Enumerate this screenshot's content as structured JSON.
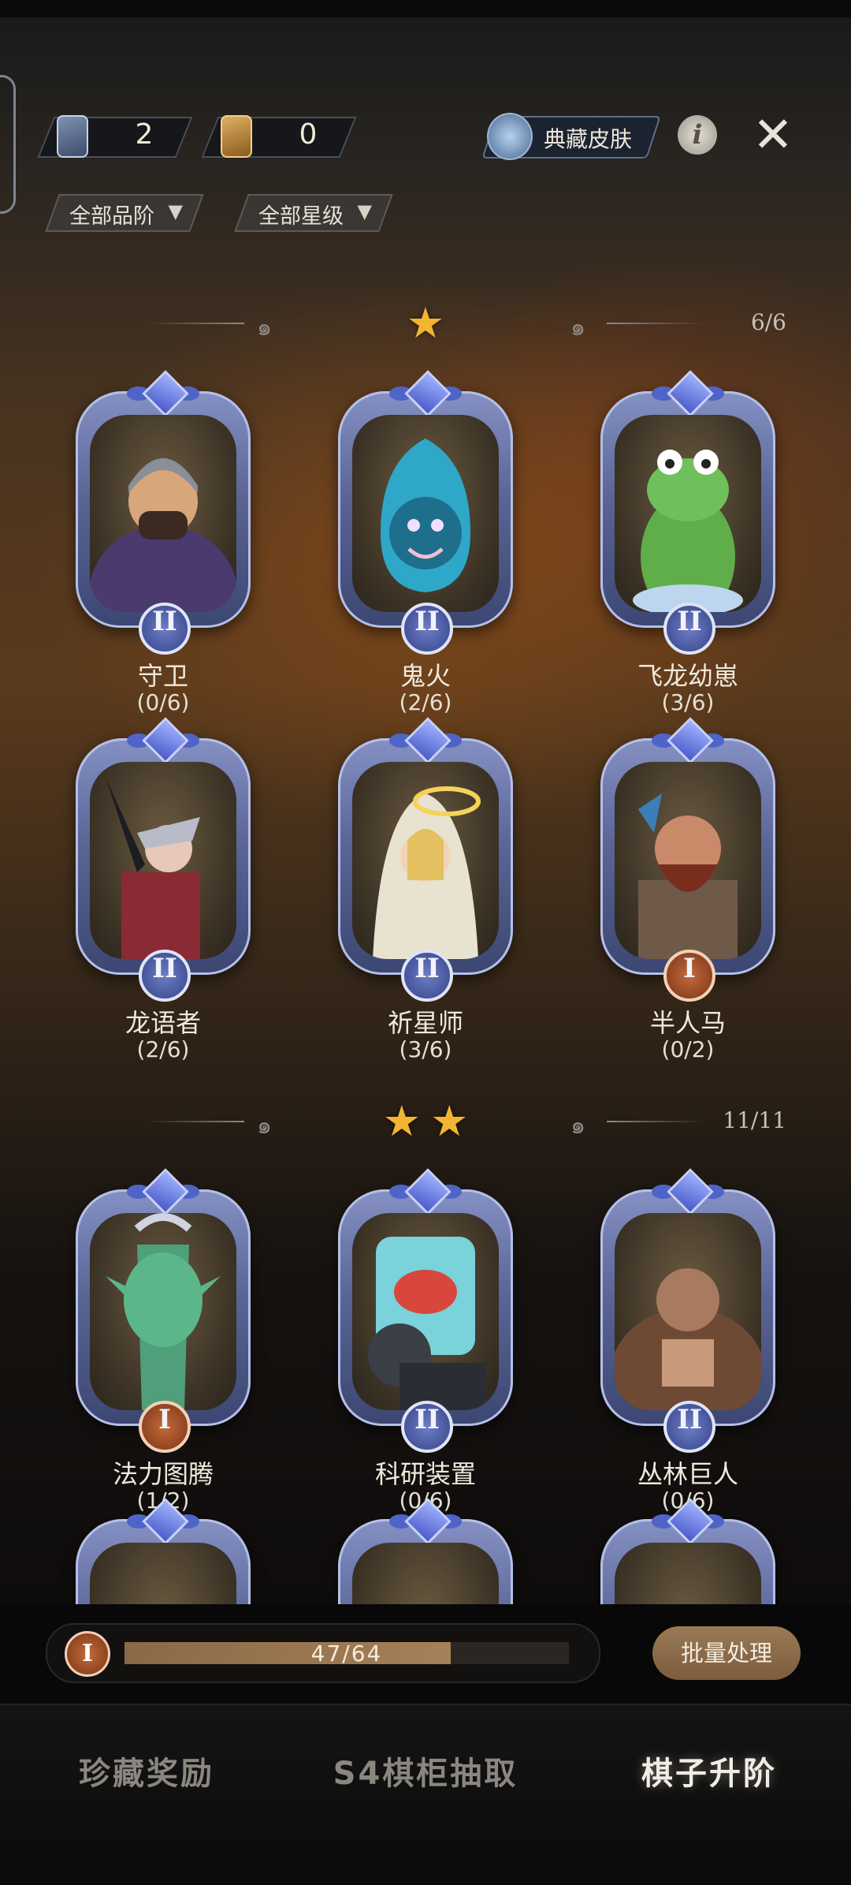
{
  "resources": [
    {
      "icon": "blue-card-icon",
      "value": "2"
    },
    {
      "icon": "gold-card-icon",
      "value": "0"
    }
  ],
  "skin_button": {
    "icon": "shirt-icon",
    "label": "典藏皮肤"
  },
  "filters": [
    {
      "label": "全部品阶"
    },
    {
      "label": "全部星级"
    }
  ],
  "sections": [
    {
      "stars": 1,
      "count": "6/6",
      "cards": [
        {
          "name": "守卫",
          "progress": "(0/6)",
          "rank": "II",
          "rank_color": "#4a5ab0"
        },
        {
          "name": "鬼火",
          "progress": "(2/6)",
          "rank": "II",
          "rank_color": "#4a5ab0"
        },
        {
          "name": "飞龙幼崽",
          "progress": "(3/6)",
          "rank": "II",
          "rank_color": "#4a5ab0"
        },
        {
          "name": "龙语者",
          "progress": "(2/6)",
          "rank": "II",
          "rank_color": "#4a5ab0"
        },
        {
          "name": "祈星师",
          "progress": "(3/6)",
          "rank": "II",
          "rank_color": "#4a5ab0"
        },
        {
          "name": "半人马",
          "progress": "(0/2)",
          "rank": "I",
          "rank_color": "#a4532c"
        }
      ]
    },
    {
      "stars": 2,
      "count": "11/11",
      "cards": [
        {
          "name": "法力图腾",
          "progress": "(1/2)",
          "rank": "I",
          "rank_color": "#a4532c"
        },
        {
          "name": "科研装置",
          "progress": "(0/6)",
          "rank": "II",
          "rank_color": "#4a5ab0"
        },
        {
          "name": "丛林巨人",
          "progress": "(0/6)",
          "rank": "II",
          "rank_color": "#4a5ab0"
        }
      ]
    }
  ],
  "upgrade_progress": {
    "rank": "I",
    "current": 47,
    "total": 64,
    "text": "47/64"
  },
  "batch_button": {
    "label": "批量处理"
  },
  "tabs": [
    {
      "label": "珍藏奖励",
      "active": false
    },
    {
      "label": "S4棋柜抽取",
      "active": false
    },
    {
      "label": "棋子升阶",
      "active": true
    }
  ],
  "colors": {
    "star": "#f2b531",
    "accent_bronze": "#a4532c",
    "accent_blue": "#4a5ab0"
  }
}
